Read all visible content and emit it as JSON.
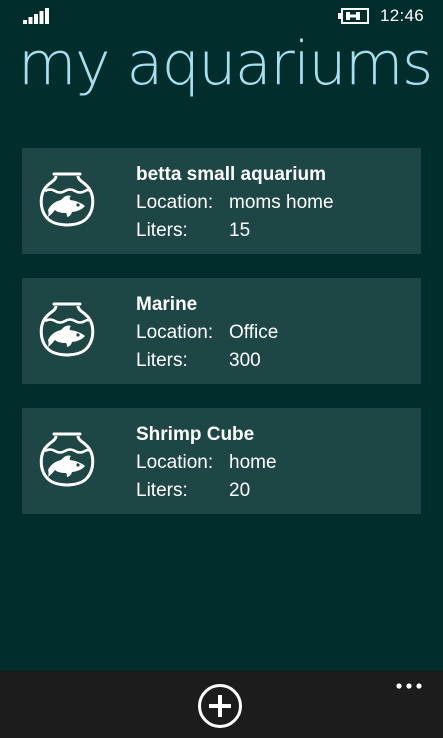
{
  "status_bar": {
    "time": "12:46",
    "signal_icon": "signal-bars-icon",
    "battery_icon": "battery-charging-icon"
  },
  "page": {
    "title": "my aquariums"
  },
  "aquariums": [
    {
      "name": "betta small aquarium",
      "location_label": "Location:",
      "location": "moms home",
      "liters_label": "Liters:",
      "liters": "15",
      "icon": "fishbowl-icon"
    },
    {
      "name": "Marine",
      "location_label": "Location:",
      "location": "Office",
      "liters_label": "Liters:",
      "liters": "300",
      "icon": "fishbowl-icon"
    },
    {
      "name": "Shrimp Cube",
      "location_label": "Location:",
      "location": "home",
      "liters_label": "Liters:",
      "liters": "20",
      "icon": "fishbowl-icon"
    }
  ],
  "app_bar": {
    "add_icon": "add-circle-icon",
    "more_icon": "more-dots-icon"
  },
  "colors": {
    "background": "#022d2d",
    "card": "#1d4645",
    "title": "#a7dfee",
    "app_bar": "#1c1c1c"
  }
}
